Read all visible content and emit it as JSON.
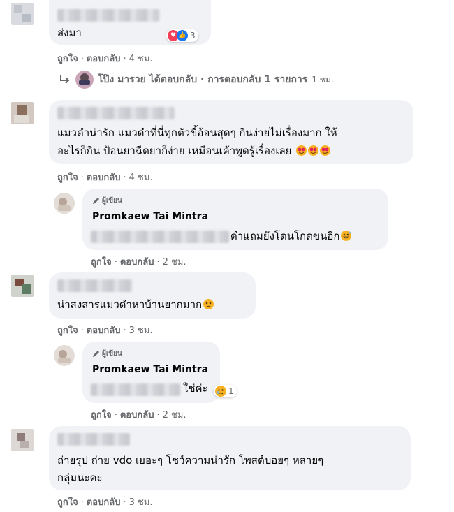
{
  "actions": {
    "like": "ถูกใจ",
    "reply": "ตอบกลับ",
    "dot": "·"
  },
  "comments": [
    {
      "text1": "ส่งมา",
      "time": "4 ชม.",
      "reaction_count": "3"
    },
    {
      "text1": "แมวดำน่ารัก แมวดำที่นี่ทุกตัวขี้อ้อนสุดๆ กินง่ายไม่เรื่องมาก ให้",
      "text2": "อะไรก็กิน ป้อนยาฉีดยาก็ง่าย เหมือนเค้าพูดรู้เรื่องเลย",
      "time": "4 ชม."
    },
    {
      "text1": "น่าสงสารแมวดำหาบ้านยากมาก",
      "time": "3 ชม."
    },
    {
      "text1": "ถ่ายรุป ถ่าย vdo เยอะๆ โชว์ความน่ารัก โพสต์บ่อยๆ หลายๆ",
      "text2": "กลุ่มนะคะ",
      "time": "3 ชม."
    }
  ],
  "reply_summary": {
    "text": "โป๊ง มารวย ได้ตอบกลับ · การตอบกลับ 1 รายการ",
    "time": "1 ชม."
  },
  "replies": [
    {
      "author_badge": "ผู้เขียน",
      "name": "Promkaew Tai Mintra",
      "text": "ดำแถมยังโดนโกดขนอีก",
      "time": "2 ชม."
    },
    {
      "author_badge": "ผู้เขียน",
      "name": "Promkaew Tai Mintra",
      "text": "ใช่ค่ะ",
      "time": "2 ชม.",
      "reaction_count": "1"
    }
  ],
  "colors": {
    "bubble": "#f0f2f5",
    "meta": "#65676b",
    "text": "#050505"
  }
}
